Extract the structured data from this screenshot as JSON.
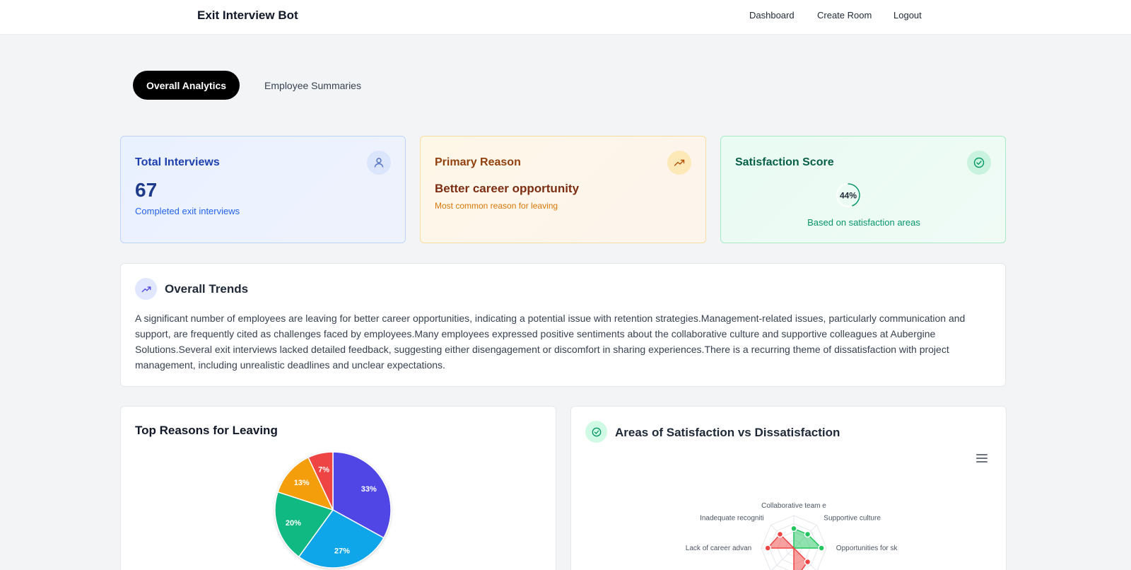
{
  "header": {
    "title": "Exit Interview Bot",
    "nav": [
      "Dashboard",
      "Create Room",
      "Logout"
    ]
  },
  "tabs": {
    "overall": "Overall Analytics",
    "summaries": "Employee Summaries"
  },
  "cards": {
    "total": {
      "title": "Total Interviews",
      "value": "67",
      "caption": "Completed exit interviews",
      "icon": "user-icon"
    },
    "reason": {
      "title": "Primary Reason",
      "value": "Better career opportunity",
      "caption": "Most common reason for leaving",
      "icon": "trending-up-icon"
    },
    "satisfaction": {
      "title": "Satisfaction Score",
      "value": "44%",
      "caption": "Based on satisfaction areas",
      "icon": "check-circle-icon",
      "score_fraction": 0.44
    }
  },
  "trends": {
    "title": "Overall Trends",
    "text": "A significant number of employees are leaving for better career opportunities, indicating a potential issue with retention strategies.Management-related issues, particularly communication and support, are frequently cited as challenges faced by employees.Many employees expressed positive sentiments about the collaborative culture and supportive colleagues at Aubergine Solutions.Several exit interviews lacked detailed feedback, suggesting either disengagement or discomfort in sharing experiences.There is a recurring theme of dissatisfaction with project management, including unrealistic deadlines and unclear expectations."
  },
  "reasons_panel": {
    "title": "Top Reasons for Leaving"
  },
  "areas_panel": {
    "title": "Areas of Satisfaction vs Dissatisfaction"
  },
  "chart_data": [
    {
      "type": "pie",
      "title": "Top Reasons for Leaving",
      "slices": [
        {
          "label": "33%",
          "value": 33,
          "color": "#4f46e5"
        },
        {
          "label": "27%",
          "value": 27,
          "color": "#0ea5e9"
        },
        {
          "label": "20%",
          "value": 20,
          "color": "#10b981"
        },
        {
          "label": "13%",
          "value": 13,
          "color": "#f59e0b"
        },
        {
          "label": "7%",
          "value": 7,
          "color": "#ef4444"
        }
      ]
    },
    {
      "type": "radar",
      "title": "Areas of Satisfaction vs Dissatisfaction",
      "axes": [
        "Collaborative team e",
        "Supportive culture",
        "Opportunities for sk",
        "",
        "",
        "",
        "Lack of career advan",
        "Inadequate recogniti"
      ],
      "series": [
        {
          "color": "#22c55e",
          "values": [
            0.6,
            0.6,
            0.85,
            0,
            0,
            0,
            0,
            0
          ]
        },
        {
          "color": "#ef4444",
          "values": [
            0,
            0,
            0,
            0.6,
            1,
            0,
            0.8,
            0.6
          ]
        }
      ]
    }
  ]
}
